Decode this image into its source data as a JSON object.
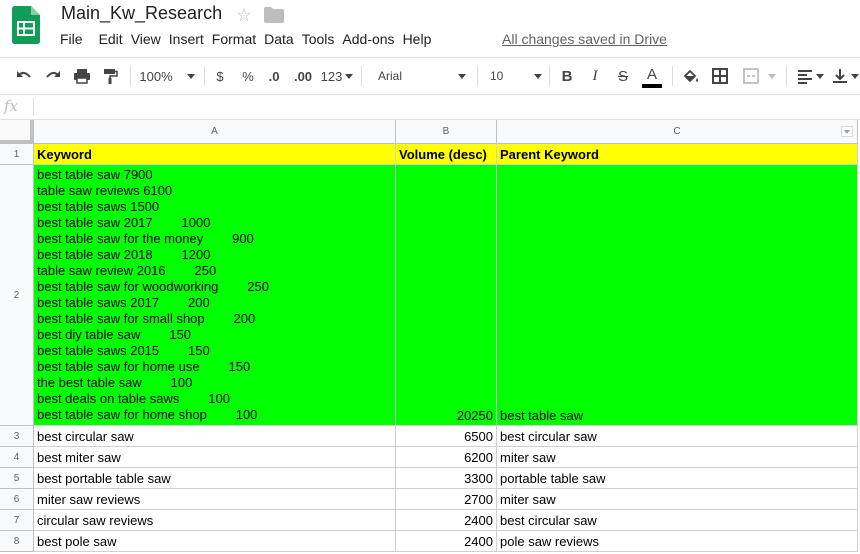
{
  "app": {
    "title": "Main_Kw_Research",
    "saved_status": "All changes saved in Drive",
    "menu": [
      "File",
      "Edit",
      "View",
      "Insert",
      "Format",
      "Data",
      "Tools",
      "Add-ons",
      "Help"
    ]
  },
  "toolbar": {
    "zoom": "100%",
    "currency": "$",
    "percent": "%",
    "decimal_decrease": ".0",
    "decimal_increase": ".00",
    "more_formats": "123",
    "font": "Arial",
    "font_size": "10",
    "bold": "B",
    "italic": "I",
    "strikethrough": "S",
    "text_color": "A",
    "text_color_value": "#000000",
    "icons": [
      "undo-icon",
      "redo-icon",
      "print-icon",
      "paint-format-icon",
      "fill-color-icon",
      "borders-icon",
      "merge-cells-icon",
      "align-left-icon",
      "vertical-align-icon"
    ]
  },
  "formula_bar": {
    "fx": "fx",
    "value": ""
  },
  "columns": [
    "A",
    "B",
    "C"
  ],
  "colors": {
    "header_fill": "#ffff00",
    "highlight_fill": "#00ff00"
  },
  "rows": [
    {
      "num": "1",
      "a": "Keyword",
      "b": "Volume (desc)",
      "c": "Parent Keyword"
    },
    {
      "num": "2",
      "a_lines": [
        "best table saw 7900",
        "table saw reviews 6100",
        "best table saws 1500",
        "best table saw 2017        1000",
        "best table saw for the money        900",
        "best table saw 2018        1200",
        "table saw review 2016        250",
        "best table saw for woodworking        250",
        "best table saws 2017        200",
        "best table saw for small shop        200",
        "best diy table saw        150",
        "best table saws 2015        150",
        "best table saw for home use        150",
        "the best table saw        100",
        "best deals on table saws        100",
        "best table saw for home shop        100"
      ],
      "b": "20250",
      "c": "best table saw"
    },
    {
      "num": "3",
      "a": "best circular saw",
      "b": "6500",
      "c": "best circular saw"
    },
    {
      "num": "4",
      "a": "best miter saw",
      "b": "6200",
      "c": "miter saw"
    },
    {
      "num": "5",
      "a": "best portable table saw",
      "b": "3300",
      "c": "portable table saw"
    },
    {
      "num": "6",
      "a": "miter saw reviews",
      "b": "2700",
      "c": "miter saw"
    },
    {
      "num": "7",
      "a": "circular saw reviews",
      "b": "2400",
      "c": "best circular saw"
    },
    {
      "num": "8",
      "a": "best pole saw",
      "b": "2400",
      "c": "pole saw reviews"
    }
  ]
}
